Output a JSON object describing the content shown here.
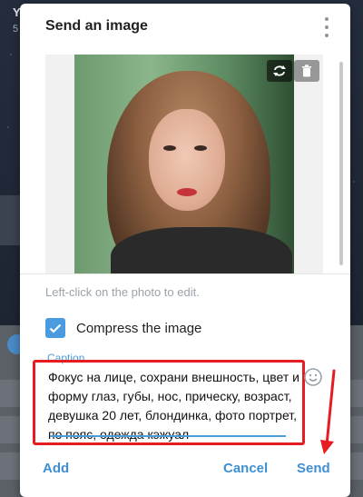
{
  "background": {
    "chat_title": "Y",
    "chat_subtitle": "5"
  },
  "dialog": {
    "title": "Send an image",
    "menu_icon": "more-vertical-icon",
    "photo_tools": [
      "refresh-icon",
      "trash-icon"
    ],
    "hint": "Left-click on the photo to edit.",
    "compress": {
      "label": "Compress the image",
      "checked": true
    },
    "caption": {
      "label": "Caption",
      "value": "Фокус на лице, сохрани внешность, цвет и форму глаз, губы, нос, прическу, возраст, девушка 20 лет, блондинка, фото портрет, по пояс, одежда кэжуал"
    },
    "emoji_icon": "smile-icon",
    "buttons": {
      "add": "Add",
      "cancel": "Cancel",
      "send": "Send"
    }
  },
  "colors": {
    "accent": "#4b9be0",
    "link": "#3f8fd2",
    "highlight": "#e51d22"
  }
}
